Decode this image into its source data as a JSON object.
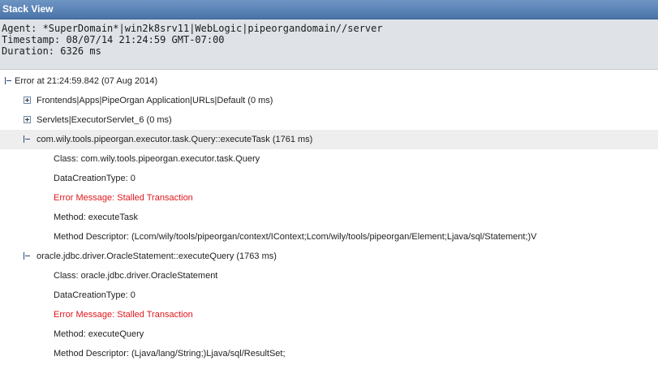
{
  "panel": {
    "title": "Stack View"
  },
  "info": {
    "agent": "Agent: *SuperDomain*|win2k8srv11|WebLogic|pipeorgandomain//server",
    "timestamp": "Timestamp: 08/07/14 21:24:59 GMT-07:00",
    "duration": "Duration: 6326 ms"
  },
  "tree": {
    "root": {
      "label": "Error at 21:24:59.842 (07 Aug 2014)",
      "toggle": "collapse"
    },
    "frontends": {
      "label": "Frontends|Apps|PipeOrgan Application|URLs|Default (0 ms)",
      "toggle": "expand"
    },
    "servlets": {
      "label": "Servlets|ExecutorServlet_6 (0 ms)",
      "toggle": "expand"
    },
    "query_task": {
      "label": "com.wily.tools.pipeorgan.executor.task.Query::executeTask (1761 ms)",
      "toggle": "collapse",
      "class": "Class: com.wily.tools.pipeorgan.executor.task.Query",
      "data_creation_type": "DataCreationType: 0",
      "error_message": "Error Message: Stalled Transaction",
      "method": "Method: executeTask",
      "method_descriptor": "Method Descriptor: (Lcom/wily/tools/pipeorgan/context/IContext;Lcom/wily/tools/pipeorgan/Element;Ljava/sql/Statement;)V"
    },
    "oracle_query": {
      "label": "oracle.jdbc.driver.OracleStatement::executeQuery (1763 ms)",
      "toggle": "collapse",
      "class": "Class: oracle.jdbc.driver.OracleStatement",
      "data_creation_type": "DataCreationType: 0",
      "error_message": "Error Message: Stalled Transaction",
      "method": "Method: executeQuery",
      "method_descriptor": "Method Descriptor: (Ljava/lang/String;)Ljava/sql/ResultSet;"
    }
  },
  "colors": {
    "title_bar": "#5a82b6",
    "info_bg": "#dfe3e8",
    "error_text": "#e0161b",
    "highlight_row": "#eeeeee"
  }
}
